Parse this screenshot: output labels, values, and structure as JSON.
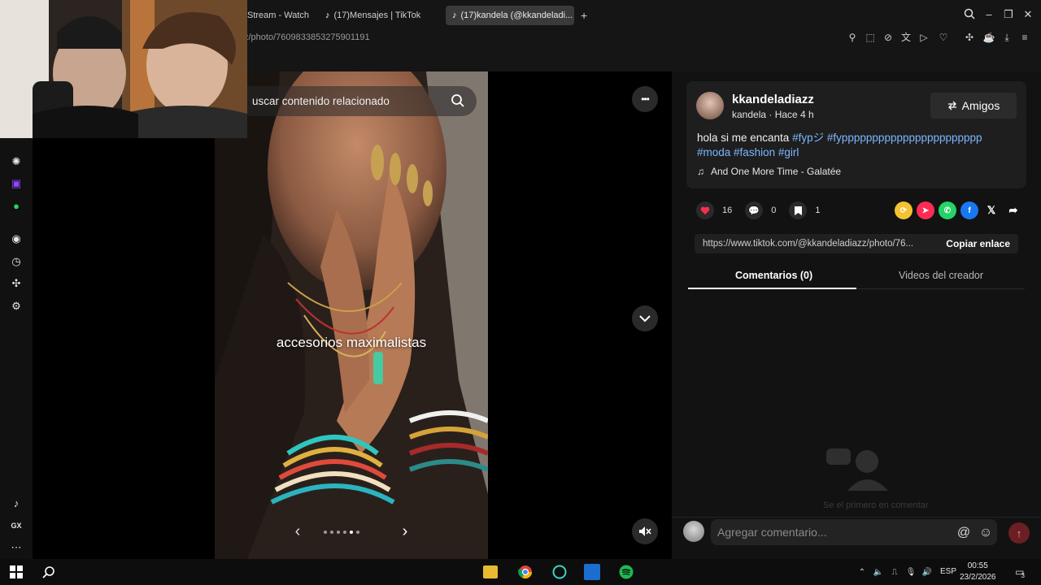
{
  "browser": {
    "tabs": [
      {
        "label": "Stream - Watch",
        "active": false
      },
      {
        "label": "(17)Mensajes | TikTok",
        "active": false
      },
      {
        "label": "(17)kandela (@kkandeladi...",
        "active": true
      }
    ],
    "new_tab_label": "+",
    "url": "z/photo/7609833853275901191"
  },
  "video": {
    "search_placeholder": "uscar contenido relacionado",
    "caption": "accesorios maximalistas",
    "more_label": "•••",
    "down_label": "⌄",
    "prev_label": "‹",
    "next_label": "›",
    "mute_label": "🔇",
    "photo_count": 6,
    "current_photo": 5
  },
  "post": {
    "username": "kkandeladiazz",
    "subline": "kandela · Hace 4 h",
    "friends_label": "Amigos",
    "description_text": "hola si me encanta ",
    "hashtags": [
      "#fypジ",
      "#fyppppppppppppppppppppppp",
      "#moda",
      "#fashion",
      "#girl"
    ],
    "music": "And One More Time - Galatée",
    "likes": "16",
    "comments": "0",
    "saves": "1",
    "link": "https://www.tiktok.com/@kkandeladiazz/photo/76...",
    "copy_label": "Copiar enlace",
    "tab_comments": "Comentarios (0)",
    "tab_creator": "Videos del creador",
    "empty_text": "Se el primero en comentar",
    "comment_placeholder": "Agregar comentario...",
    "share_colors": [
      "#f2c230",
      "#fe2c55",
      "#25d366",
      "#1877f2",
      "#121212"
    ]
  },
  "taskbar": {
    "lang": "ESP",
    "time": "00:55",
    "date": "23/2/2026",
    "notifications": "3"
  },
  "colors": {
    "accent_red": "#fe2c55",
    "hashtag_blue": "#7cb7ff"
  }
}
